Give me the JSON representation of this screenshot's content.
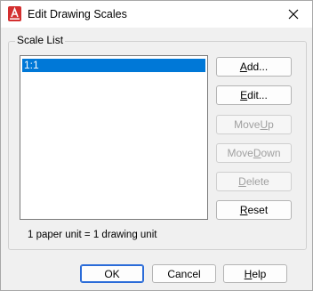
{
  "window": {
    "title": "Edit Drawing Scales"
  },
  "group": {
    "label": "Scale List"
  },
  "scale_list": {
    "items": [
      "1:1"
    ],
    "selected_index": 0
  },
  "buttons": {
    "add": {
      "pre": "",
      "ul": "A",
      "post": "dd..."
    },
    "edit": {
      "pre": "",
      "ul": "E",
      "post": "dit..."
    },
    "move_up": {
      "pre": "Move ",
      "ul": "U",
      "post": "p"
    },
    "move_down": {
      "pre": "Move ",
      "ul": "D",
      "post": "own"
    },
    "delete": {
      "pre": "",
      "ul": "D",
      "post": "elete"
    },
    "reset": {
      "pre": "",
      "ul": "R",
      "post": "eset"
    }
  },
  "status_text": "1 paper unit = 1 drawing unit",
  "footer": {
    "ok": "OK",
    "cancel": "Cancel",
    "help": {
      "pre": "",
      "ul": "H",
      "post": "elp"
    }
  },
  "colors": {
    "accent": "#0078d7",
    "app_icon": "#d32f2f",
    "default_border": "#2a6bd8"
  }
}
